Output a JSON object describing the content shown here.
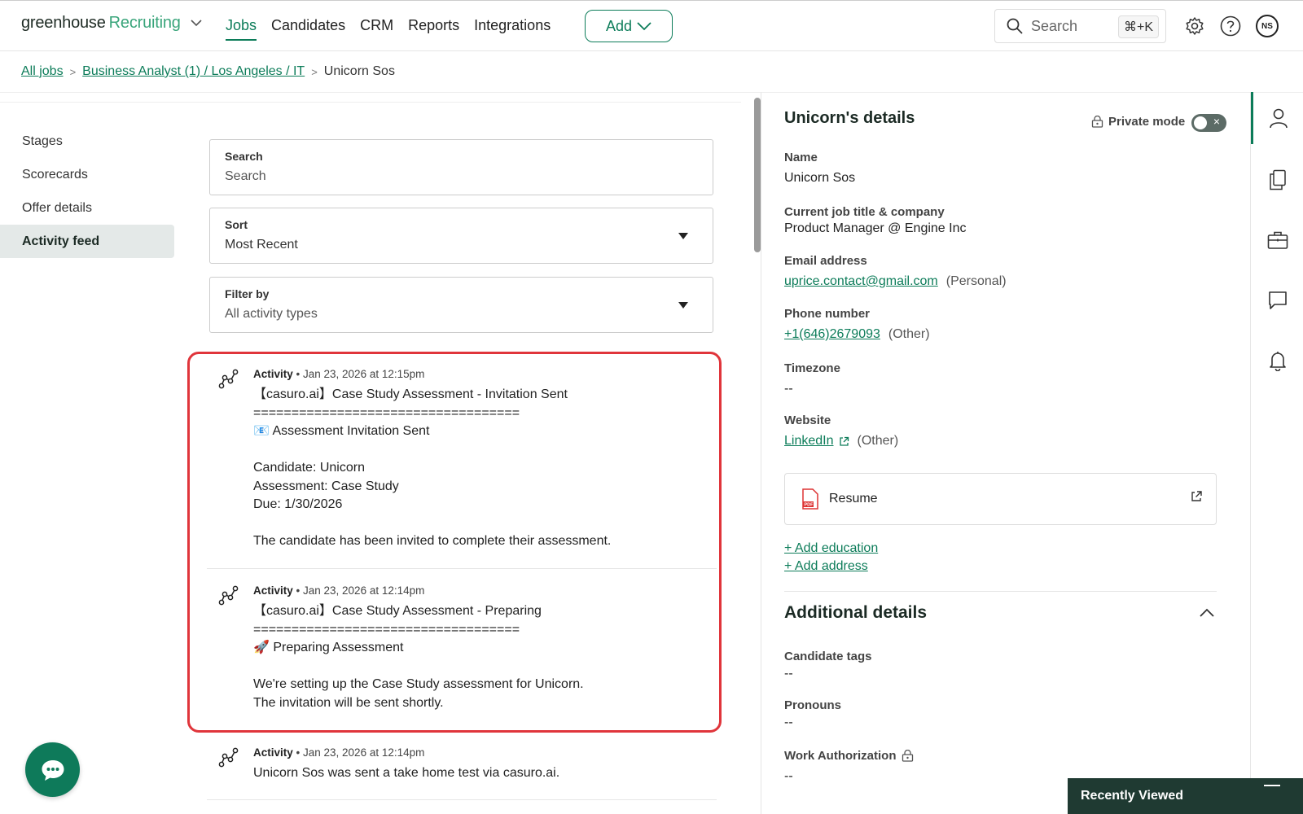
{
  "topnav": {
    "logo_main": "greenhouse",
    "logo_product": "Recruiting",
    "links": [
      "Jobs",
      "Candidates",
      "CRM",
      "Reports",
      "Integrations"
    ],
    "add_label": "Add",
    "search_placeholder": "Search",
    "search_shortcut": "⌘+K",
    "avatar_initials": "NS"
  },
  "breadcrumb": {
    "all_jobs": "All jobs",
    "job": "Business Analyst (1) / Los Angeles / IT",
    "candidate": "Unicorn Sos"
  },
  "sidenav": {
    "items": [
      "Stages",
      "Scorecards",
      "Offer details",
      "Activity feed"
    ]
  },
  "filters": {
    "search_label": "Search",
    "search_placeholder": "Search",
    "sort_label": "Sort",
    "sort_value": "Most Recent",
    "filter_label": "Filter by",
    "filter_value": "All activity types"
  },
  "activities": [
    {
      "type": "Activity",
      "date": " • Jan 23, 2026 at 12:15pm",
      "body": "【casuro.ai】Case Study Assessment - Invitation Sent\n===================================\n📧 Assessment Invitation Sent\n\nCandidate: Unicorn\nAssessment: Case Study\nDue: 1/30/2026\n\nThe candidate has been invited to complete their assessment."
    },
    {
      "type": "Activity",
      "date": " • Jan 23, 2026 at 12:14pm",
      "body": "【casuro.ai】Case Study Assessment - Preparing\n===================================\n🚀 Preparing Assessment\n\nWe're setting up the Case Study assessment for Unicorn.\nThe invitation will be sent shortly."
    },
    {
      "type": "Activity",
      "date": " • Jan 23, 2026 at 12:14pm",
      "body": "Unicorn Sos was sent a take home test via casuro.ai."
    }
  ],
  "details": {
    "title": "Unicorn's details",
    "private_mode": "Private mode",
    "name_label": "Name",
    "name_value": "Unicorn Sos",
    "job_label": "Current job title & company",
    "job_value": "Product Manager @ Engine Inc",
    "email_label": "Email address",
    "email_value": "uprice.contact@gmail.com",
    "email_type": "(Personal)",
    "phone_label": "Phone number",
    "phone_value": "+1(646)2679093",
    "phone_type": "(Other)",
    "timezone_label": "Timezone",
    "timezone_value": "--",
    "website_label": "Website",
    "website_value": "LinkedIn",
    "website_type": "(Other)",
    "resume_label": "Resume",
    "add_education": "+ Add education",
    "add_address": "+ Add address"
  },
  "additional": {
    "title": "Additional details",
    "tags_label": "Candidate tags",
    "tags_value": "--",
    "pronouns_label": "Pronouns",
    "pronouns_value": "--",
    "work_auth_label": "Work Authorization",
    "work_auth_value": "--"
  },
  "recently_viewed": "Recently Viewed",
  "colors": {
    "brand_green": "#0c7c59",
    "highlight_red": "#e0353b",
    "active_nav_bg": "#e4e9e8",
    "chat_bubble": "#0e7a5a",
    "recent_bar": "#1f3a32"
  }
}
